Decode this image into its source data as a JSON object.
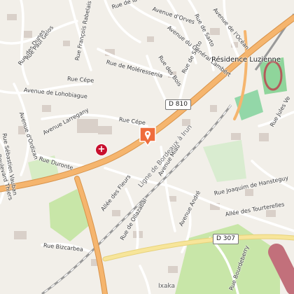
{
  "map": {
    "accent_road_color": "#f5b56e",
    "building_color": "#d9d0c9",
    "park_color": "#c8e6a8",
    "water_color": "#aad3df",
    "marker_color": "#ef6c3c",
    "streets": [
      "Rue des Dunes",
      "Rue Paul Gelos",
      "Rue François Rabelais",
      "Rue de la Paix",
      "Avenue d'Orves",
      "Avenue du Général Lambért",
      "Rue de Sarto",
      "Avenue de l'Océan",
      "Rue de Moléressenia",
      "Rue des Bois",
      "Rue de Sarto",
      "Rue Cépe",
      "Avenue de Lohobiague",
      "Avenue Larregany",
      "Rue Cépe",
      "Rue Jules Ve",
      "Rue Sébastien Vauban",
      "Avenue d'Ordizan",
      "Boulevard Thiers",
      "Rue Duronte",
      "Ligne de Bordeaux à Irun",
      "Avenue Miau",
      "Allée des Fleurs",
      "Avenue André",
      "Rue Joaquim de Hansteguy",
      "Allée des Tourterelles",
      "Rue de Ollazabal",
      "Rue Bizcarbea",
      "Rue Bourdeberry",
      "Rue Ixaka"
    ],
    "places": {
      "residence": "Résidence Luzienne",
      "ixaka": "Ixaka"
    },
    "road_shields": [
      "D 810",
      "D 307"
    ],
    "poi_icons": [
      "hospital-icon",
      "location-marker-icon"
    ]
  }
}
